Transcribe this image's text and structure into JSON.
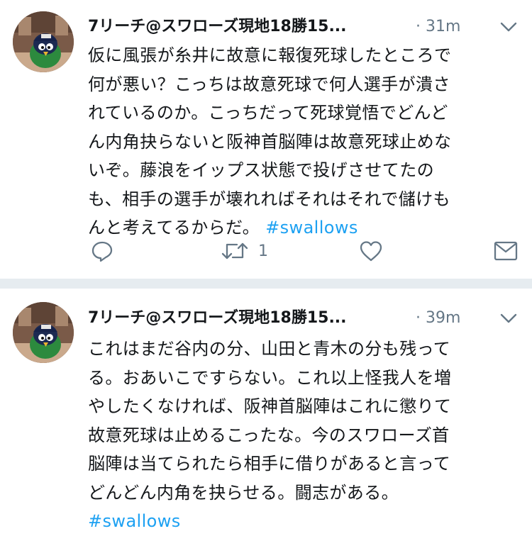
{
  "tweets": [
    {
      "display_name": "7リーチ@スワローズ現地18勝15...",
      "timestamp": "· 31m",
      "lines": [
        "仮に風張が糸井に故意に報復死球したところで",
        "何が悪い？こっちは故意死球で何人選手が潰さ",
        "れているのか。こっちだって死球覚悟でどんど",
        "ん内角抉らないと阪神首脳陣は故意死球止めな",
        "いぞ。藤浪をイップス状態で投げさせてたの",
        "も、相手の選手が壊れればそれはそれで儲けも",
        "んと考えてるからだ。"
      ],
      "hashtag": "#swallows",
      "retweet_count": "1",
      "avatar_icon": "avatar-swallow-mascot",
      "menu_icon": "chevron-down-icon"
    },
    {
      "display_name": "7リーチ@スワローズ現地18勝15...",
      "timestamp": "· 39m",
      "lines": [
        "これはまだ谷内の分、山田と青木の分も残って",
        "る。おあいこですらない。これ以上怪我人を増",
        "やしたくなければ、阪神首脳陣はこれに懲りて",
        "故意死球は止めるこったな。今のスワローズ首",
        "脳陣は当てられたら相手に借りがあると言って",
        "どんどん内角を抉らせる。闘志がある。"
      ],
      "hashtag": "#swallows",
      "avatar_icon": "avatar-swallow-mascot",
      "menu_icon": "chevron-down-icon"
    }
  ],
  "icons": {
    "reply": "reply-icon",
    "retweet": "retweet-icon",
    "like": "heart-icon",
    "message": "envelope-icon"
  },
  "colors": {
    "hashtag": "#1da1f2",
    "meta": "#657786",
    "text": "#14171a",
    "divider": "#e6ecf0"
  }
}
